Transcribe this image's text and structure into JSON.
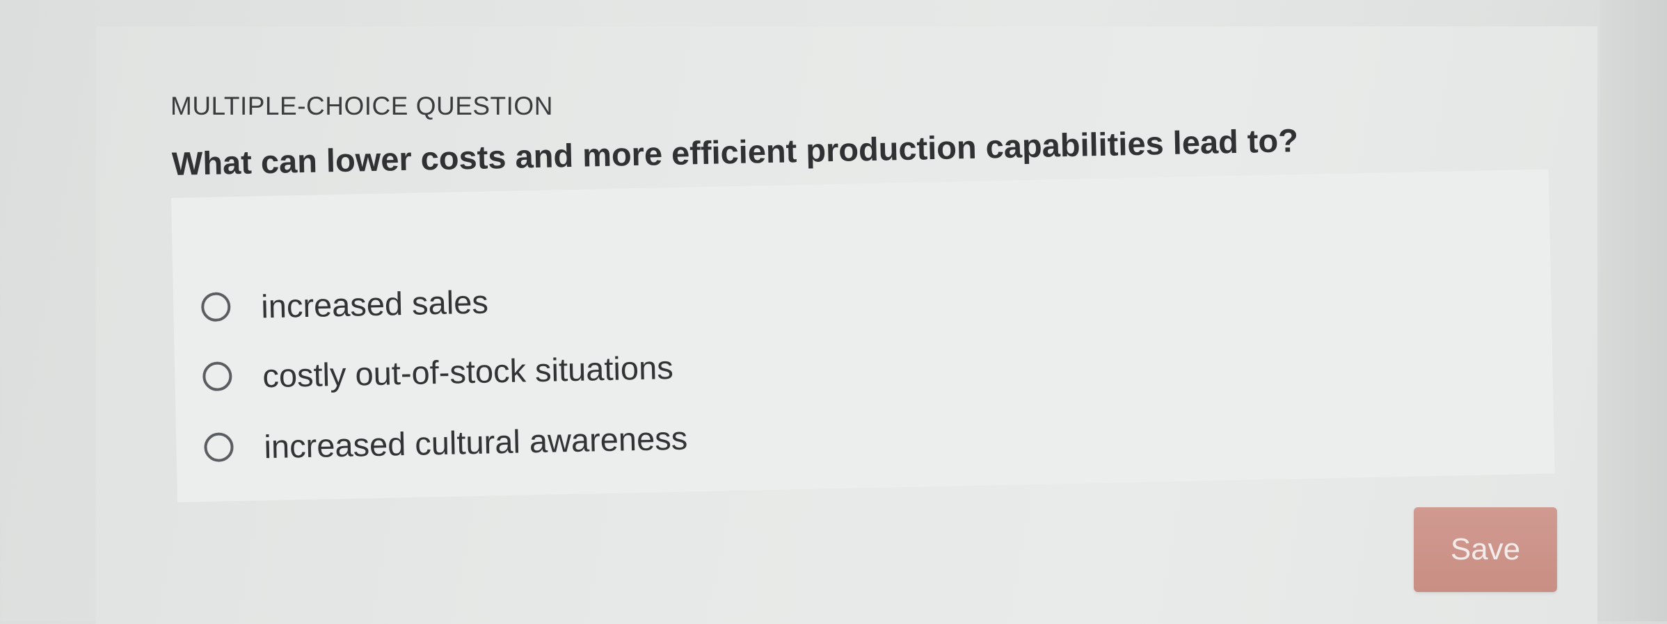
{
  "section": {
    "label": "MULTIPLE-CHOICE QUESTION"
  },
  "question": {
    "text": "What can lower costs and more efficient production capabilities lead to?"
  },
  "options": [
    {
      "label": "increased sales",
      "selected": false
    },
    {
      "label": "costly out-of-stock situations",
      "selected": false
    },
    {
      "label": "increased cultural awareness",
      "selected": false
    }
  ],
  "actions": {
    "save_label": "Save",
    "save_color": "#c98e84"
  }
}
